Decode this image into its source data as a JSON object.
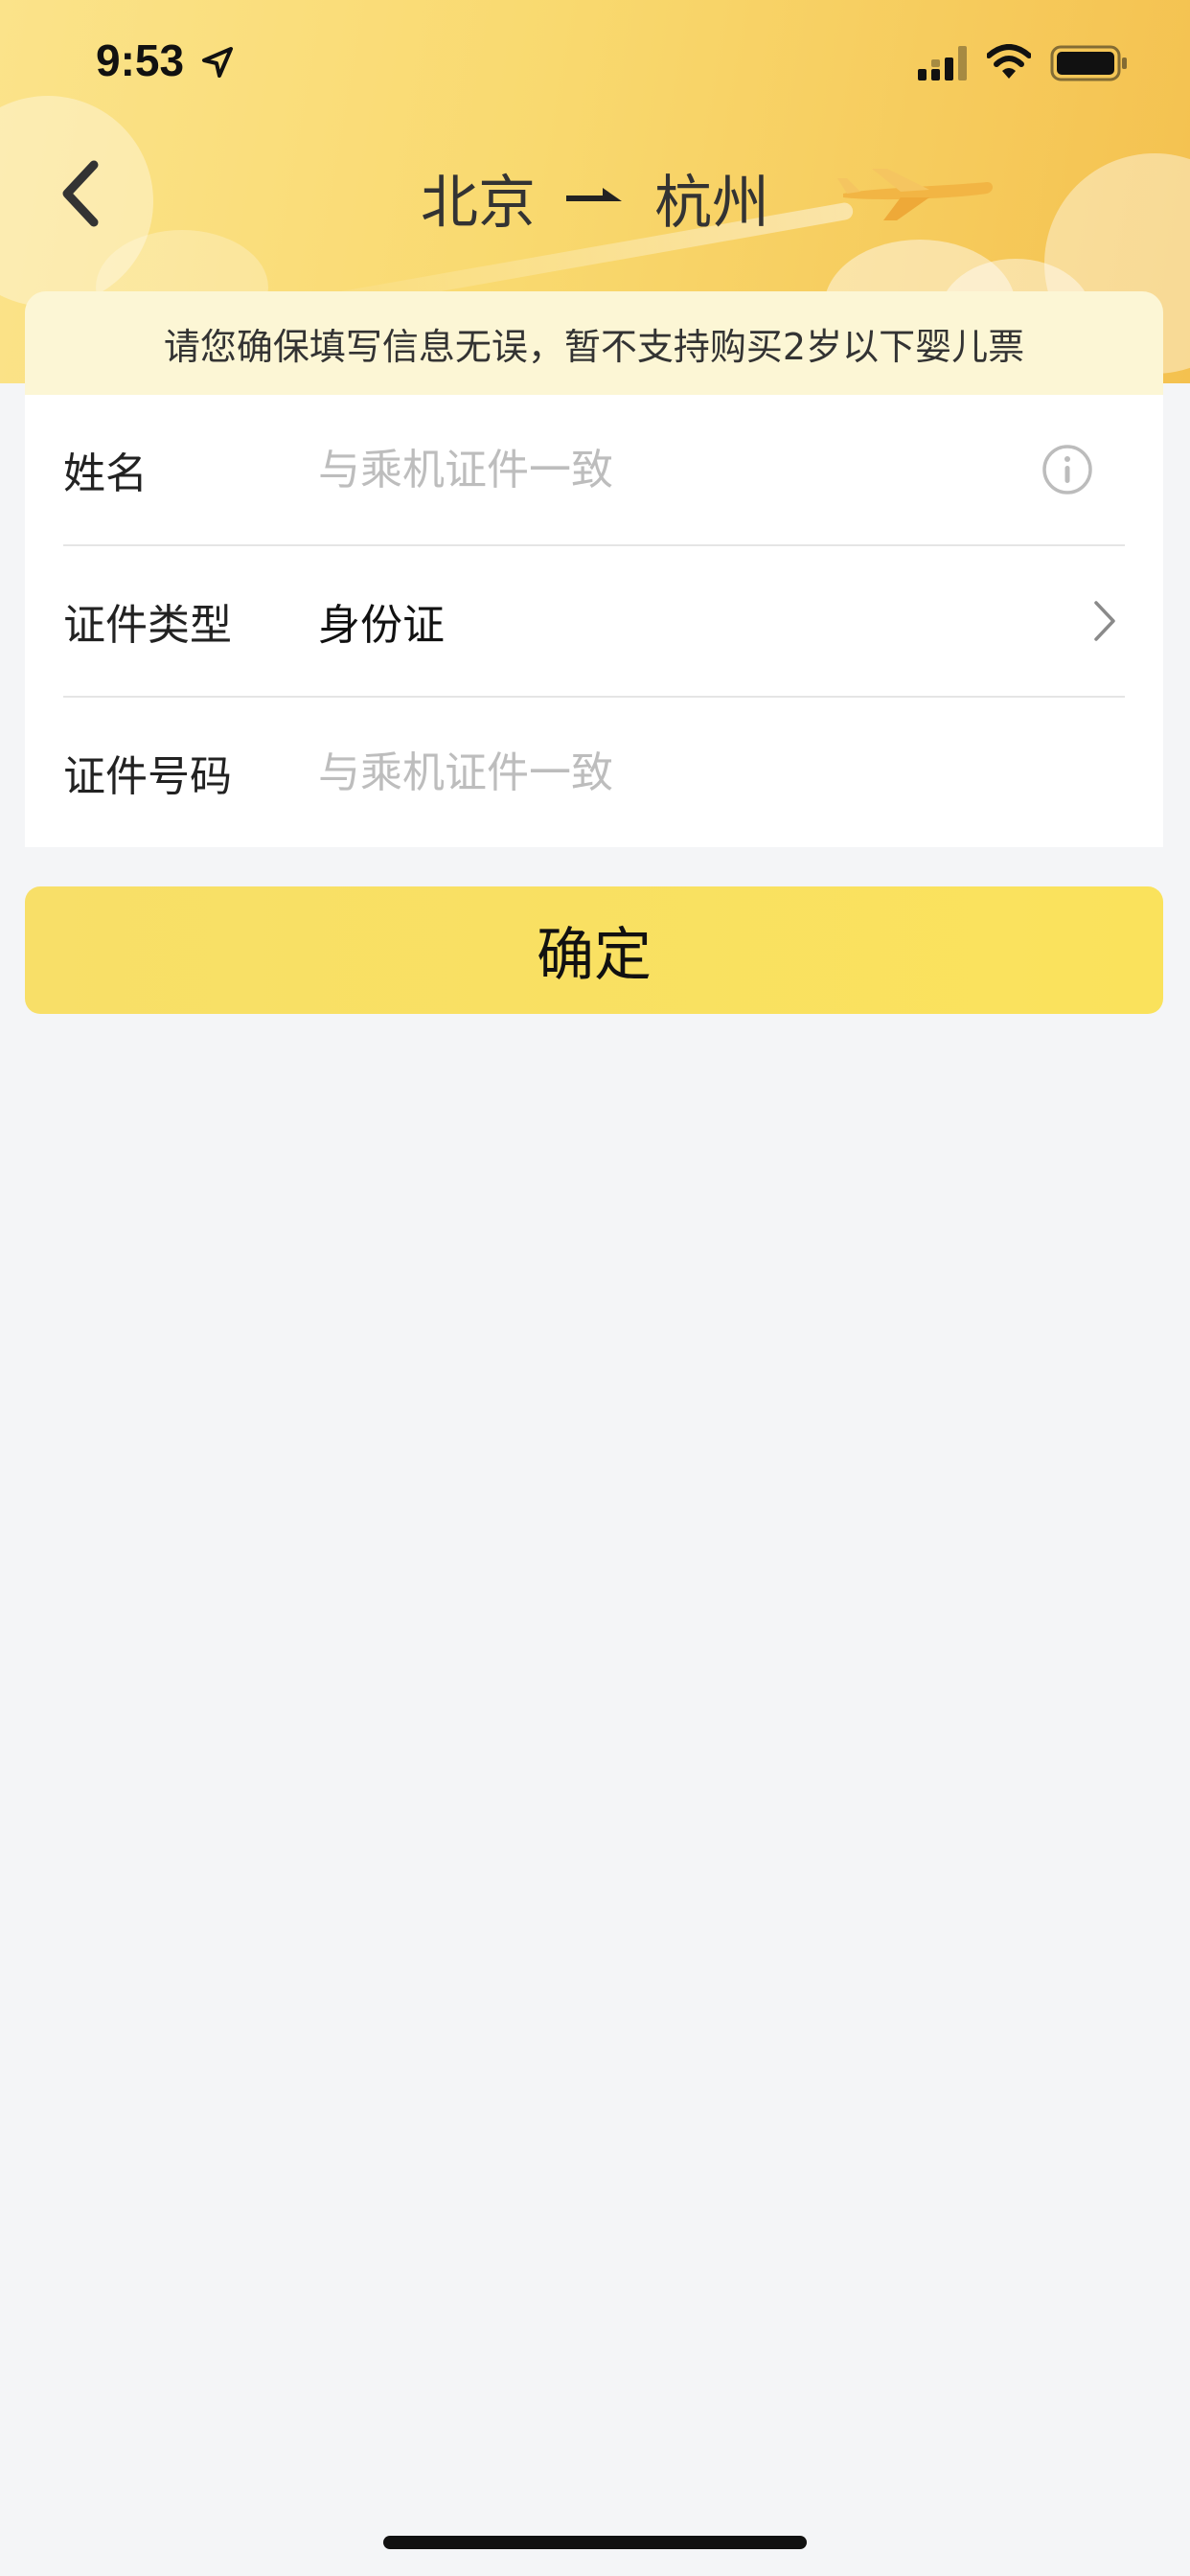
{
  "status_bar": {
    "time": "9:53"
  },
  "header": {
    "origin": "北京",
    "destination": "杭州"
  },
  "notice": {
    "text": "请您确保填写信息无误，暂不支持购买2岁以下婴儿票"
  },
  "form": {
    "name": {
      "label": "姓名",
      "placeholder": "与乘机证件一致",
      "value": ""
    },
    "id_type": {
      "label": "证件类型",
      "value": "身份证"
    },
    "id_number": {
      "label": "证件号码",
      "placeholder": "与乘机证件一致",
      "value": ""
    }
  },
  "confirm_label": "确定",
  "colors": {
    "accent": "#f9df64",
    "notice_bg": "#fcf6d5",
    "header_from": "#fbe38a",
    "header_to": "#f4c14f"
  }
}
